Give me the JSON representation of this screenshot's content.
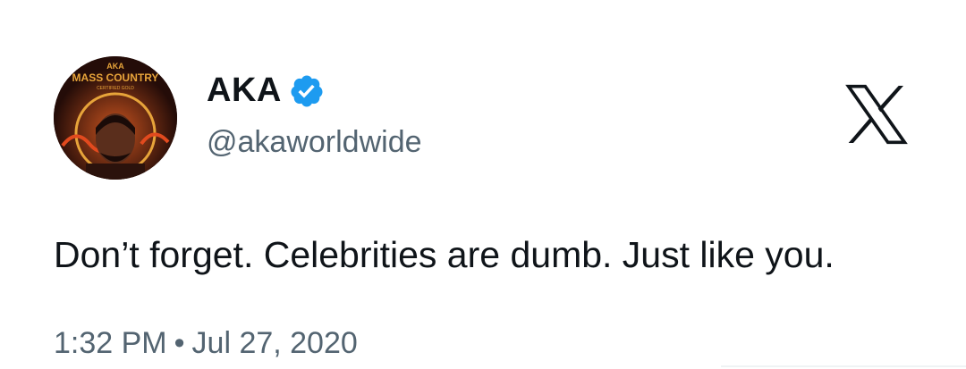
{
  "author": {
    "display_name": "AKA",
    "handle": "@akaworldwide",
    "verified": true,
    "avatar_logo_text": "AKA",
    "avatar_title_text": "MASS COUNTRY",
    "avatar_subtitle_text": "CERTIFIED GOLD"
  },
  "platform_icon": "x-logo-icon",
  "tweet": {
    "text": "Don’t forget. Celebrities are dumb. Just like you.",
    "time": "1:32 PM",
    "separator": "•",
    "date": "Jul 27, 2020"
  },
  "colors": {
    "verified": "#1d9bf0",
    "text": "#0f1419",
    "secondary": "#536471"
  }
}
